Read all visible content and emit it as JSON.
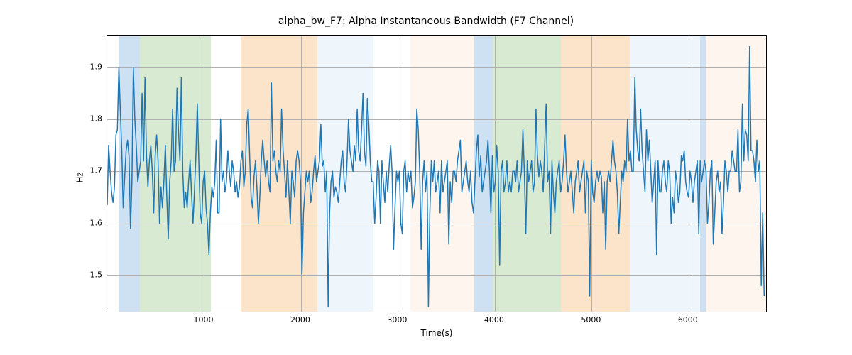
{
  "chart_data": {
    "type": "line",
    "title": "alpha_bw_F7: Alpha Instantaneous Bandwidth (F7 Channel)",
    "xlabel": "Time(s)",
    "ylabel": "Hz",
    "xlim": [
      0,
      6800
    ],
    "ylim": [
      1.43,
      1.96
    ],
    "xticks": [
      1000,
      2000,
      3000,
      4000,
      5000,
      6000
    ],
    "yticks": [
      1.5,
      1.6,
      1.7,
      1.8,
      1.9
    ],
    "shaded_regions": [
      {
        "x0": 120,
        "x1": 340,
        "color": "blue"
      },
      {
        "x0": 340,
        "x1": 1070,
        "color": "green"
      },
      {
        "x0": 1380,
        "x1": 2170,
        "color": "orange"
      },
      {
        "x0": 2170,
        "x1": 2750,
        "color": "lightblue"
      },
      {
        "x0": 3130,
        "x1": 3790,
        "color": "lightorange"
      },
      {
        "x0": 3790,
        "x1": 3980,
        "color": "blue"
      },
      {
        "x0": 3980,
        "x1": 4680,
        "color": "green"
      },
      {
        "x0": 4680,
        "x1": 5390,
        "color": "orange"
      },
      {
        "x0": 5390,
        "x1": 6120,
        "color": "lightblue"
      },
      {
        "x0": 6120,
        "x1": 6180,
        "color": "blue"
      },
      {
        "x0": 6180,
        "x1": 6800,
        "color": "lightorange"
      }
    ],
    "series": [
      {
        "name": "alpha_bw_F7",
        "x_step": 15,
        "values": [
          1.635,
          1.75,
          1.7,
          1.66,
          1.64,
          1.67,
          1.77,
          1.78,
          1.9,
          1.82,
          1.74,
          1.63,
          1.69,
          1.74,
          1.76,
          1.73,
          1.59,
          1.68,
          1.9,
          1.8,
          1.75,
          1.68,
          1.7,
          1.72,
          1.85,
          1.72,
          1.88,
          1.73,
          1.67,
          1.72,
          1.75,
          1.7,
          1.62,
          1.73,
          1.77,
          1.72,
          1.6,
          1.67,
          1.63,
          1.68,
          1.75,
          1.65,
          1.57,
          1.68,
          1.72,
          1.82,
          1.7,
          1.72,
          1.86,
          1.78,
          1.72,
          1.88,
          1.7,
          1.63,
          1.66,
          1.63,
          1.68,
          1.72,
          1.66,
          1.6,
          1.66,
          1.73,
          1.83,
          1.72,
          1.62,
          1.6,
          1.68,
          1.7,
          1.63,
          1.6,
          1.54,
          1.62,
          1.67,
          1.65,
          1.68,
          1.76,
          1.62,
          1.62,
          1.8,
          1.68,
          1.7,
          1.66,
          1.68,
          1.74,
          1.7,
          1.67,
          1.72,
          1.7,
          1.66,
          1.68,
          1.65,
          1.67,
          1.72,
          1.74,
          1.67,
          1.7,
          1.79,
          1.82,
          1.73,
          1.65,
          1.63,
          1.69,
          1.72,
          1.67,
          1.6,
          1.65,
          1.72,
          1.76,
          1.72,
          1.69,
          1.72,
          1.68,
          1.66,
          1.87,
          1.72,
          1.74,
          1.7,
          1.68,
          1.72,
          1.7,
          1.82,
          1.74,
          1.7,
          1.65,
          1.72,
          1.66,
          1.6,
          1.7,
          1.68,
          1.65,
          1.72,
          1.74,
          1.72,
          1.68,
          1.5,
          1.62,
          1.66,
          1.7,
          1.68,
          1.7,
          1.64,
          1.66,
          1.7,
          1.73,
          1.68,
          1.7,
          1.72,
          1.79,
          1.71,
          1.72,
          1.66,
          1.7,
          1.44,
          1.62,
          1.68,
          1.7,
          1.65,
          1.67,
          1.66,
          1.64,
          1.68,
          1.72,
          1.74,
          1.68,
          1.66,
          1.72,
          1.8,
          1.74,
          1.72,
          1.7,
          1.75,
          1.72,
          1.82,
          1.74,
          1.72,
          1.78,
          1.85,
          1.74,
          1.71,
          1.84,
          1.79,
          1.72,
          1.68,
          1.68,
          1.6,
          1.65,
          1.72,
          1.7,
          1.6,
          1.72,
          1.68,
          1.64,
          1.7,
          1.66,
          1.71,
          1.75,
          1.7,
          1.55,
          1.63,
          1.7,
          1.68,
          1.7,
          1.6,
          1.58,
          1.7,
          1.72,
          1.66,
          1.7,
          1.68,
          1.7,
          1.63,
          1.65,
          1.68,
          1.82,
          1.78,
          1.7,
          1.55,
          1.68,
          1.72,
          1.66,
          1.7,
          1.44,
          1.62,
          1.72,
          1.68,
          1.72,
          1.66,
          1.68,
          1.7,
          1.62,
          1.72,
          1.66,
          1.68,
          1.7,
          1.72,
          1.56,
          1.68,
          1.64,
          1.7,
          1.7,
          1.68,
          1.72,
          1.74,
          1.76,
          1.66,
          1.68,
          1.7,
          1.72,
          1.68,
          1.66,
          1.7,
          1.64,
          1.62,
          1.68,
          1.74,
          1.77,
          1.69,
          1.73,
          1.66,
          1.68,
          1.7,
          1.72,
          1.76,
          1.7,
          1.62,
          1.73,
          1.66,
          1.68,
          1.75,
          1.7,
          1.52,
          1.7,
          1.72,
          1.66,
          1.68,
          1.72,
          1.66,
          1.68,
          1.66,
          1.7,
          1.7,
          1.68,
          1.72,
          1.66,
          1.68,
          1.7,
          1.78,
          1.7,
          1.58,
          1.72,
          1.68,
          1.7,
          1.72,
          1.66,
          1.68,
          1.82,
          1.73,
          1.69,
          1.72,
          1.7,
          1.66,
          1.75,
          1.83,
          1.68,
          1.7,
          1.58,
          1.72,
          1.66,
          1.62,
          1.68,
          1.7,
          1.72,
          1.66,
          1.68,
          1.72,
          1.77,
          1.7,
          1.66,
          1.68,
          1.7,
          1.66,
          1.62,
          1.68,
          1.7,
          1.72,
          1.66,
          1.68,
          1.7,
          1.72,
          1.62,
          1.7,
          1.68,
          1.46,
          1.72,
          1.66,
          1.64,
          1.68,
          1.7,
          1.68,
          1.7,
          1.69,
          1.62,
          1.68,
          1.55,
          1.68,
          1.7,
          1.68,
          1.72,
          1.76,
          1.72,
          1.7,
          1.66,
          1.58,
          1.64,
          1.7,
          1.68,
          1.72,
          1.7,
          1.8,
          1.72,
          1.74,
          1.7,
          1.7,
          1.88,
          1.78,
          1.74,
          1.72,
          1.82,
          1.74,
          1.7,
          1.66,
          1.78,
          1.72,
          1.76,
          1.7,
          1.64,
          1.68,
          1.72,
          1.54,
          1.72,
          1.66,
          1.66,
          1.7,
          1.72,
          1.68,
          1.66,
          1.72,
          1.7,
          1.6,
          1.65,
          1.62,
          1.7,
          1.68,
          1.64,
          1.66,
          1.73,
          1.72,
          1.74,
          1.68,
          1.66,
          1.65,
          1.7,
          1.68,
          1.64,
          1.68,
          1.7,
          1.72,
          1.58,
          1.72,
          1.68,
          1.7,
          1.72,
          1.7,
          1.6,
          1.64,
          1.7,
          1.72,
          1.56,
          1.62,
          1.68,
          1.7,
          1.66,
          1.68,
          1.58,
          1.64,
          1.72,
          1.7,
          1.66,
          1.7,
          1.7,
          1.74,
          1.72,
          1.7,
          1.7,
          1.78,
          1.66,
          1.68,
          1.83,
          1.72,
          1.78,
          1.77,
          1.72,
          1.94,
          1.74,
          1.74,
          1.72,
          1.68,
          1.76,
          1.7,
          1.72,
          1.48,
          1.62,
          1.46
        ]
      }
    ]
  }
}
